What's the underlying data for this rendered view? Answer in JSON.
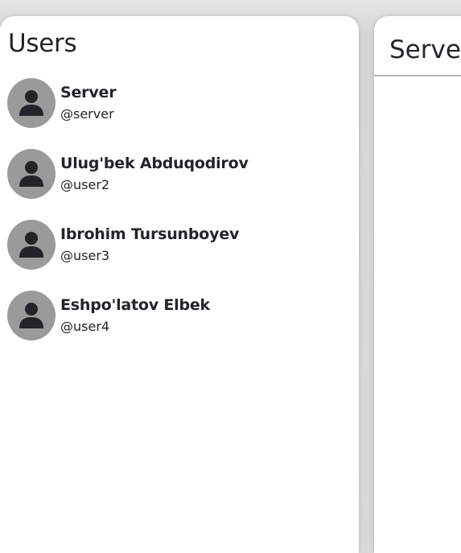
{
  "users_panel": {
    "title": "Users",
    "users": [
      {
        "name": "Server",
        "handle": "@server",
        "avatar_icon": "person-icon"
      },
      {
        "name": "Ulug'bek Abduqodirov",
        "handle": "@user2",
        "avatar_icon": "person-icon"
      },
      {
        "name": "Ibrohim Tursunboyev",
        "handle": "@user3",
        "avatar_icon": "person-icon"
      },
      {
        "name": "Eshpo'latov Elbek",
        "handle": "@user4",
        "avatar_icon": "person-icon"
      }
    ]
  },
  "chat_panel": {
    "title": "Server"
  },
  "colors": {
    "background": "#d9d9d9",
    "panel": "#ffffff",
    "avatar_bg": "#9a9a9a",
    "avatar_icon": "#212529",
    "text": "#212529",
    "divider": "#b5b5b5"
  }
}
